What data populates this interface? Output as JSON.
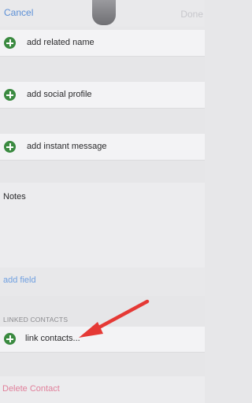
{
  "nav": {
    "cancel_label": "Cancel",
    "done_label": "Done"
  },
  "rows": {
    "related_name": "add related name",
    "social_profile": "add social profile",
    "instant_message": "add instant message",
    "link_contacts": "link contacts..."
  },
  "notes": {
    "title": "Notes"
  },
  "add_field_label": "add field",
  "linked_contacts_header": "LINKED CONTACTS",
  "delete_label": "Delete Contact",
  "colors": {
    "accent_blue": "#5b8fd6",
    "add_green": "#3a8a40",
    "destructive_pink": "#e07f9a",
    "arrow_red": "#e53935"
  }
}
